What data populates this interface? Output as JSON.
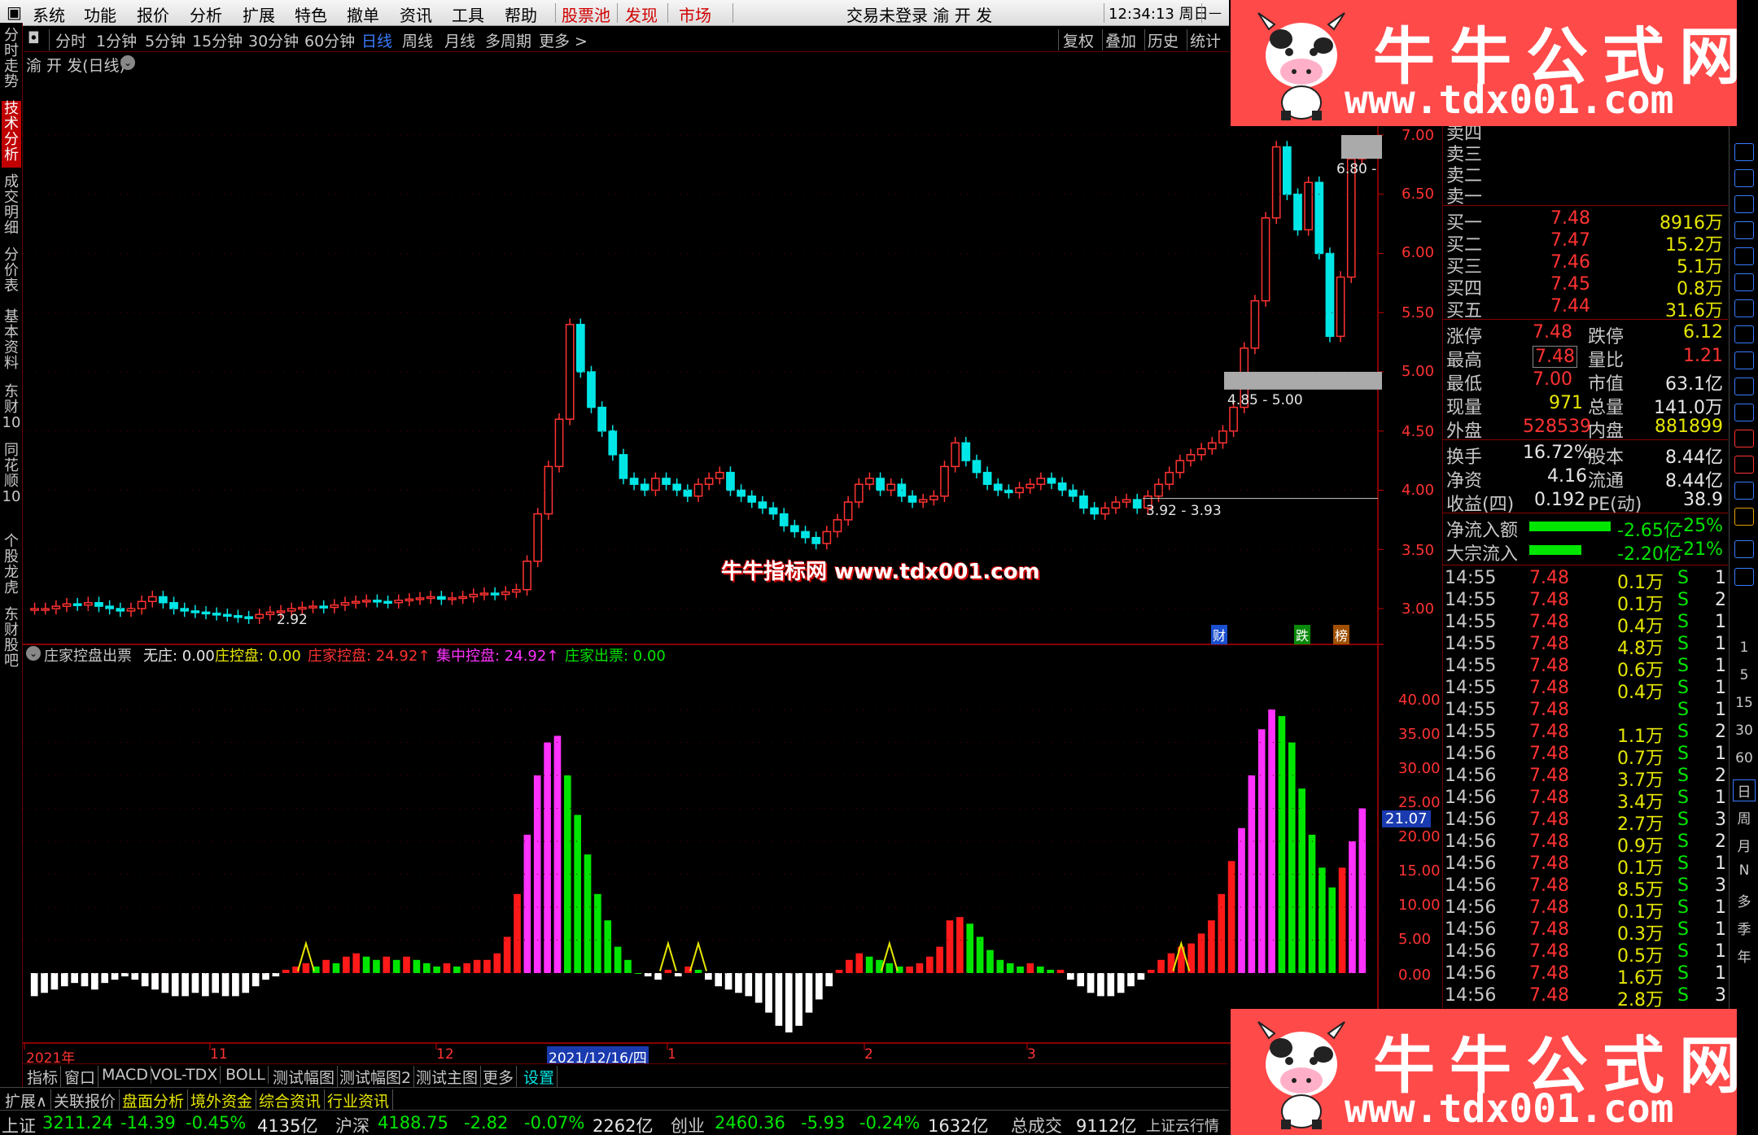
{
  "menu": {
    "items": [
      "系统",
      "功能",
      "报价",
      "分析",
      "扩展",
      "特色",
      "撤单",
      "资讯",
      "工具",
      "帮助"
    ],
    "red_items": [
      "股票池",
      "发现",
      "市场"
    ],
    "title": "交易未登录 渝 开 发",
    "clock": "12:34:13 周日"
  },
  "toolbar": {
    "periods": [
      "分时",
      "1分钟",
      "5分钟",
      "15分钟",
      "30分钟",
      "60分钟",
      "日线",
      "周线",
      "月线",
      "多周期",
      "更多 >"
    ],
    "active_period": "日线",
    "right": [
      "复权",
      "叠加",
      "历史",
      "统计"
    ]
  },
  "left_tabs": [
    "分时走势",
    "技术分析",
    "成交明细",
    "分价表",
    "基本资料",
    "东财10",
    "同花顺10",
    "个股龙虎",
    "东财股吧"
  ],
  "active_left_tab": "技术分析",
  "chart": {
    "stock_title": "渝 开 发(日线)",
    "low_label": "2.92",
    "price_axis": [
      "7.00",
      "6.50",
      "6.00",
      "5.50",
      "5.00",
      "4.50",
      "4.00",
      "3.50",
      "3.00"
    ],
    "zone_labels": [
      "6.80 -",
      "4.85 - 5.00",
      "3.92 - 3.93"
    ],
    "markers": [
      "财",
      "跌",
      "榜"
    ],
    "indicator_title": "庄家控盘出票",
    "indicator_legend": [
      {
        "label": "无庄: 0.00",
        "color": "#e6e6e6"
      },
      {
        "label": "庄控盘: 0.00",
        "color": "#e6e600"
      },
      {
        "label": "庄家控盘: 24.92↑",
        "color": "#ff3232"
      },
      {
        "label": "集中控盘: 24.92↑",
        "color": "#ff32ff"
      },
      {
        "label": "庄家出票: 0.00",
        "color": "#00e600"
      }
    ],
    "ind_axis": [
      "40.00",
      "35.00",
      "30.00",
      "25.00",
      "20.00",
      "15.00",
      "10.00",
      "5.00",
      "0.00"
    ],
    "ind_current": "21.07",
    "date_axis": [
      "2021年",
      "11",
      "12",
      "2021/12/16/四",
      "1",
      "2",
      "3"
    ],
    "center_watermark": "牛牛指标网 www.tdx001.com"
  },
  "chart_data": {
    "type": "bar",
    "title": "庄家控盘出票",
    "ylim": [
      -10,
      45
    ],
    "values": [
      -3.5,
      -3,
      -2.5,
      -2,
      -1.5,
      -2,
      -2.5,
      -1.5,
      -1,
      -0.5,
      -1,
      -2,
      -2.5,
      -3,
      -3.5,
      -3.5,
      -3,
      -3.5,
      -3,
      -3.5,
      -3.5,
      -3,
      -2,
      -1,
      -0.5,
      0.5,
      1,
      1.5,
      1,
      2,
      1.5,
      2.5,
      3,
      2.5,
      2,
      2.5,
      2,
      2.5,
      2,
      1.5,
      1,
      1.5,
      1,
      1.5,
      2,
      2,
      3,
      5.5,
      12,
      21,
      30,
      35,
      36,
      30,
      24,
      18,
      12,
      8,
      4,
      2,
      0,
      -0.5,
      -1,
      0.5,
      -0.5,
      1,
      0.5,
      -1,
      -2,
      -2.5,
      -3,
      -3.5,
      -4.5,
      -6,
      -8,
      -9,
      -8,
      -6,
      -4,
      -2,
      0.5,
      2,
      3,
      2.5,
      2,
      1.5,
      1,
      1,
      1.5,
      2.5,
      4,
      8,
      8.5,
      7.5,
      5.5,
      3.5,
      2,
      1.5,
      1,
      1.5,
      1,
      0.5,
      0.5,
      -1,
      -2,
      -3,
      -3.5,
      -3.5,
      -3,
      -2,
      -1,
      0.5,
      2,
      3,
      4,
      4.5,
      6,
      8,
      12,
      17,
      22,
      30,
      37,
      40,
      39,
      35,
      28,
      21,
      16,
      13,
      16,
      20,
      25
    ]
  },
  "quote": {
    "sell_rows": [
      "卖四",
      "卖三",
      "卖二",
      "卖一"
    ],
    "buy_rows": [
      {
        "label": "买一",
        "price": "7.48",
        "vol": "8916万"
      },
      {
        "label": "买二",
        "price": "7.47",
        "vol": "15.2万"
      },
      {
        "label": "买三",
        "price": "7.46",
        "vol": "5.1万"
      },
      {
        "label": "买四",
        "price": "7.45",
        "vol": "0.8万"
      },
      {
        "label": "买五",
        "price": "7.44",
        "vol": "31.6万"
      }
    ],
    "stats": [
      {
        "l1": "涨停",
        "v1": "7.48",
        "c1": "red",
        "l2": "跌停",
        "v2": "6.12",
        "c2": "yel"
      },
      {
        "l1": "最高",
        "v1": "7.48",
        "c1": "red",
        "l2": "量比",
        "v2": "1.21",
        "c2": "red"
      },
      {
        "l1": "最低",
        "v1": "7.00",
        "c1": "red",
        "l2": "市值",
        "v2": "63.1亿",
        "c2": "wht"
      },
      {
        "l1": "现量",
        "v1": "971",
        "c1": "yel",
        "l2": "总量",
        "v2": "141.0万",
        "c2": "wht"
      },
      {
        "l1": "外盘",
        "v1": "528539",
        "c1": "red",
        "l2": "内盘",
        "v2": "881899",
        "c2": "yel"
      }
    ],
    "stats2": [
      {
        "l1": "换手",
        "v1": "16.72%",
        "l2": "股本",
        "v2": "8.44亿"
      },
      {
        "l1": "净资",
        "v1": "4.16",
        "l2": "流通",
        "v2": "8.44亿"
      },
      {
        "l1": "收益(四)",
        "v1": "0.192",
        "l2": "PE(动)",
        "v2": "38.9"
      }
    ],
    "flows": [
      {
        "label": "净流入额",
        "value": "-2.65亿",
        "pct": "-25%"
      },
      {
        "label": "大宗流入",
        "value": "-2.20亿",
        "pct": "-21%"
      }
    ],
    "ticks": [
      {
        "t": "14:55",
        "p": "7.48",
        "v": "0.1万",
        "s": "S",
        "n": "1"
      },
      {
        "t": "14:55",
        "p": "7.48",
        "v": "0.1万",
        "s": "S",
        "n": "2"
      },
      {
        "t": "14:55",
        "p": "7.48",
        "v": "0.4万",
        "s": "S",
        "n": "1"
      },
      {
        "t": "14:55",
        "p": "7.48",
        "v": "4.8万",
        "s": "S",
        "n": "1"
      },
      {
        "t": "14:55",
        "p": "7.48",
        "v": "0.6万",
        "s": "S",
        "n": "1"
      },
      {
        "t": "14:55",
        "p": "7.48",
        "v": "0.4万",
        "s": "S",
        "n": "1"
      },
      {
        "t": "14:55",
        "p": "7.48",
        "v": "",
        "s": "S",
        "n": "1"
      },
      {
        "t": "14:55",
        "p": "7.48",
        "v": "1.1万",
        "s": "S",
        "n": "2"
      },
      {
        "t": "14:56",
        "p": "7.48",
        "v": "0.7万",
        "s": "S",
        "n": "1"
      },
      {
        "t": "14:56",
        "p": "7.48",
        "v": "3.7万",
        "s": "S",
        "n": "2"
      },
      {
        "t": "14:56",
        "p": "7.48",
        "v": "3.4万",
        "s": "S",
        "n": "1"
      },
      {
        "t": "14:56",
        "p": "7.48",
        "v": "2.7万",
        "s": "S",
        "n": "3"
      },
      {
        "t": "14:56",
        "p": "7.48",
        "v": "0.9万",
        "s": "S",
        "n": "2"
      },
      {
        "t": "14:56",
        "p": "7.48",
        "v": "0.1万",
        "s": "S",
        "n": "1"
      },
      {
        "t": "14:56",
        "p": "7.48",
        "v": "8.5万",
        "s": "S",
        "n": "3"
      },
      {
        "t": "14:56",
        "p": "7.48",
        "v": "0.1万",
        "s": "S",
        "n": "1"
      },
      {
        "t": "14:56",
        "p": "7.48",
        "v": "0.3万",
        "s": "S",
        "n": "1"
      },
      {
        "t": "14:56",
        "p": "7.48",
        "v": "0.5万",
        "s": "S",
        "n": "1"
      },
      {
        "t": "14:56",
        "p": "7.48",
        "v": "1.6万",
        "s": "S",
        "n": "1"
      },
      {
        "t": "14:56",
        "p": "7.48",
        "v": "2.8万",
        "s": "S",
        "n": "3"
      }
    ]
  },
  "icon_strip": [
    "1",
    "5",
    "15",
    "30",
    "60",
    "日",
    "周",
    "月",
    "N",
    "多",
    "季",
    "年"
  ],
  "bottom_tabs": [
    "指标",
    "窗口",
    "MACD",
    "VOL-TDX",
    "BOLL",
    "测试幅图",
    "测试幅图2",
    "测试主图",
    "更多",
    "设置"
  ],
  "ext_tabs": [
    "扩展∧",
    "关联报价",
    "盘面分析",
    "境外资金",
    "综合资讯",
    "行业资讯"
  ],
  "status": [
    {
      "name": "上证",
      "price": "3211.24",
      "chg": "-14.39",
      "pct": "-0.45%",
      "amt": "4135亿"
    },
    {
      "name": "沪深",
      "price": "4188.75",
      "chg": "-2.82",
      "pct": "-0.07%",
      "amt": "2262亿"
    },
    {
      "name": "创业",
      "price": "2460.36",
      "chg": "-5.93",
      "pct": "-0.24%",
      "amt": "1632亿"
    }
  ],
  "status_total_label": "总成交",
  "status_total": "9112亿",
  "status_news": "上证云行情",
  "banner": {
    "title": "牛牛公式网",
    "url": "www.tdx001.com"
  },
  "colors": {
    "up": "#ff3232",
    "down": "#00e6e6",
    "magenta": "#ff32ff",
    "green": "#00e600",
    "yellow": "#e6e600",
    "brand_red": "#ff4a4a"
  }
}
